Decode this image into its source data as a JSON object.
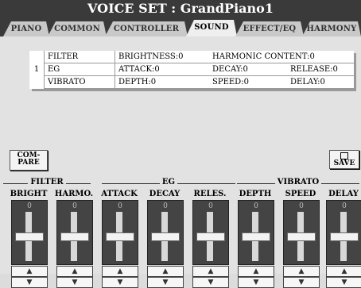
{
  "title": "VOICE SET : GrandPiano1",
  "tabs": [
    "PIANO",
    "COMMON",
    "CONTROLLER",
    "SOUND",
    "EFFECT/EQ",
    "HARMONY"
  ],
  "active_tab": "SOUND",
  "table": {
    "index": "1",
    "rows": [
      [
        "FILTER",
        "BRIGHTNESS:0",
        "HARMONIC CONTENT:0",
        ""
      ],
      [
        "EG",
        "ATTACK:0",
        "DECAY:0",
        "RELEASE:0"
      ],
      [
        "VIBRATO",
        "DEPTH:0",
        "SPEED:0",
        "DELAY:0"
      ]
    ]
  },
  "buttons": {
    "compare": "COM-\nPARE",
    "save": "SAVE",
    "save_icon": "floppy-icon"
  },
  "groups": [
    "FILTER",
    "EG",
    "VIBRATO"
  ],
  "sliders": [
    {
      "label": "BRIGHT",
      "value": "0"
    },
    {
      "label": "HARMO.",
      "value": "0"
    },
    {
      "label": "ATTACK",
      "value": "0"
    },
    {
      "label": "DECAY",
      "value": "0"
    },
    {
      "label": "RELES.",
      "value": "0"
    },
    {
      "label": "DEPTH",
      "value": "0"
    },
    {
      "label": "SPEED",
      "value": "0"
    },
    {
      "label": "DELAY",
      "value": "0"
    }
  ],
  "colors": {
    "title_bg": "#3a3a3a",
    "panel_bg": "#e2e2e2",
    "slider_bg": "#444444"
  }
}
